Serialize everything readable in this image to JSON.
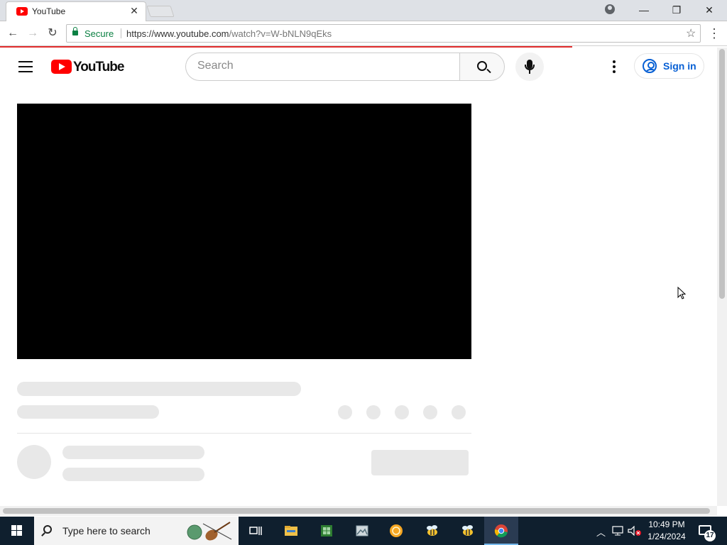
{
  "browser": {
    "tab": {
      "title": "YouTube",
      "favicon": "youtube-favicon-icon"
    },
    "address": {
      "secure_label": "Secure",
      "url_host": "https://www.youtube.com",
      "url_path": "/watch?v=W-bNLN9qEks"
    }
  },
  "youtube": {
    "logo_text": "YouTube",
    "search": {
      "placeholder": "Search"
    },
    "signin_label": "Sign in",
    "brand_color": "#ff0000",
    "link_color": "#065fd4"
  },
  "taskbar": {
    "search_placeholder": "Type here to search",
    "pinned_icons": [
      "task-view-icon",
      "file-explorer-icon",
      "spreadsheet-app-icon",
      "image-viewer-icon",
      "orange-circle-app-icon",
      "bee-app-icon",
      "bee-app-icon-2",
      "chrome-icon"
    ],
    "clock": {
      "time": "10:49 PM",
      "date": "1/24/2024"
    },
    "notification_count": "17"
  }
}
